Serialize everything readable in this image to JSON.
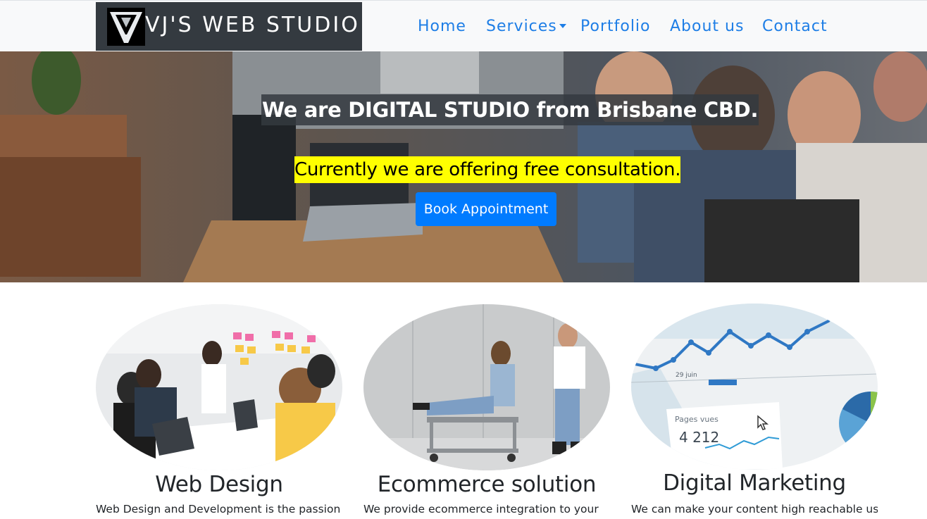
{
  "navbar": {
    "brand": "VJ'S WEB STUDIO",
    "links": [
      {
        "label": "Home"
      },
      {
        "label": "Services"
      },
      {
        "label": "Portfolio"
      },
      {
        "label": "About us"
      },
      {
        "label": "Contact"
      }
    ]
  },
  "hero": {
    "title": "We are DIGITAL STUDIO from Brisbane CBD.",
    "offer": "Currently we are offering free consultation.",
    "button": "Book Appointment"
  },
  "services": [
    {
      "title": "Web Design",
      "text": "Web Design and Development is the passion for"
    },
    {
      "title": "Ecommerce solution",
      "text": "We provide ecommerce integration to your"
    },
    {
      "title": "Digital Marketing",
      "text": "We can make your content high reachable using"
    }
  ],
  "analytics_image": {
    "date_label": "29 juin",
    "pages_label": "Pages vues",
    "pages_value": "4 212"
  },
  "colors": {
    "nav_link": "#1e7ee6",
    "brand_bg": "#343a40",
    "button": "#007bff",
    "highlight": "#ffff00"
  }
}
